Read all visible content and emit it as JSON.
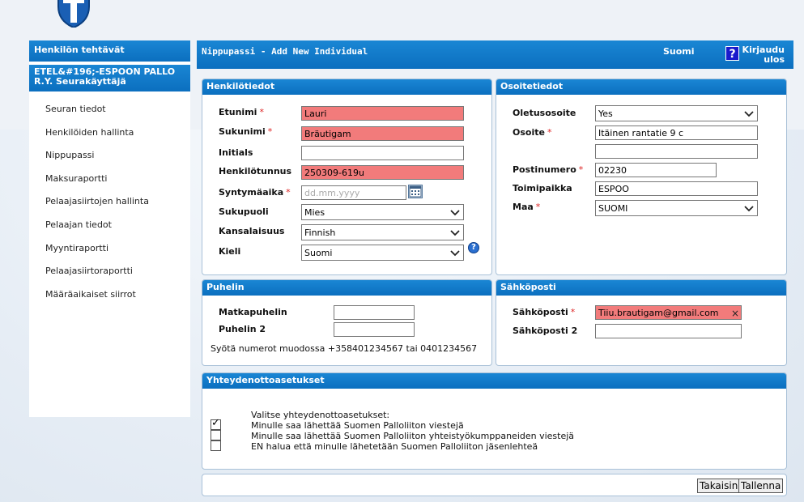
{
  "sidebar": {
    "title": "Henkilön tehtävät",
    "org": "ETEL&#196;-ESPOON PALLO R.Y. Seurakäyttäjä",
    "items": [
      {
        "label": "Seuran tiedot"
      },
      {
        "label": "Henkilöiden hallinta"
      },
      {
        "label": "Nippupassi"
      },
      {
        "label": "Maksuraportti"
      },
      {
        "label": "Pelaajasiirtojen hallinta"
      },
      {
        "label": "Pelaajan tiedot"
      },
      {
        "label": "Myyntiraportti"
      },
      {
        "label": "Pelaajasiirtoraportti"
      },
      {
        "label": "Määräaikaiset siirrot"
      }
    ]
  },
  "header": {
    "title": "Nippupassi - Add New Individual",
    "language": "Suomi",
    "help_icon": "question-icon",
    "logout": "Kirjaudu ulos"
  },
  "henkilotiedot": {
    "title": "Henkilötiedot",
    "etunimi_label": "Etunimi",
    "etunimi_value": "Lauri",
    "sukunimi_label": "Sukunimi",
    "sukunimi_value": "Bräutigam",
    "initials_label": "Initials",
    "initials_value": "",
    "hetu_label": "Henkilötunnus",
    "hetu_value": "250309-619u",
    "syntymaaika_label": "Syntymäaika",
    "syntymaaika_placeholder": "dd.mm.yyyy",
    "sukupuoli_label": "Sukupuoli",
    "sukupuoli_value": "Mies",
    "kansalaisuus_label": "Kansalaisuus",
    "kansalaisuus_value": "Finnish",
    "kieli_label": "Kieli",
    "kieli_value": "Suomi",
    "required_mark": "*"
  },
  "osoitetiedot": {
    "title": "Osoitetiedot",
    "oletusosoite_label": "Oletusosoite",
    "oletusosoite_value": "Yes",
    "osoite_label": "Osoite",
    "osoite_value": "Itäinen rantatie 9 c",
    "osoite2_value": "",
    "postinumero_label": "Postinumero",
    "postinumero_value": "02230",
    "toimipaikka_label": "Toimipaikka",
    "toimipaikka_value": "ESPOO",
    "maa_label": "Maa",
    "maa_value": "SUOMI"
  },
  "puhelin": {
    "title": "Puhelin",
    "matkapuhelin_label": "Matkapuhelin",
    "matkapuhelin_value": "",
    "puhelin2_label": "Puhelin 2",
    "puhelin2_value": "",
    "hint": "Syötä numerot muodossa +358401234567 tai 0401234567"
  },
  "sahkoposti": {
    "title": "Sähköposti",
    "email_label": "Sähköposti",
    "email_value": "Tiiu.brautigam@gmail.com",
    "clear_glyph": "×",
    "email2_label": "Sähköposti 2",
    "email2_value": ""
  },
  "yhteydenotto": {
    "title": "Yhteydenottoasetukset",
    "intro": "Valitse yhteydenottoasetukset:",
    "options": [
      {
        "label": "Minulle saa lähettää Suomen Palloliiton viestejä",
        "checked": true,
        "mark": "✓"
      },
      {
        "label": "Minulle saa lähettää Suomen Palloliiton yhteistyökumppaneiden viestejä",
        "checked": false,
        "mark": ""
      },
      {
        "label": "EN halua että minulle lähetetään Suomen Palloliiton jäsenlehteä",
        "checked": false,
        "mark": ""
      }
    ]
  },
  "actions": {
    "back": "Takaisin",
    "save": "Tallenna"
  },
  "colors": {
    "header_blue": "#0b6fbf",
    "error_fill": "#f27b7b",
    "required": "#d22222"
  }
}
